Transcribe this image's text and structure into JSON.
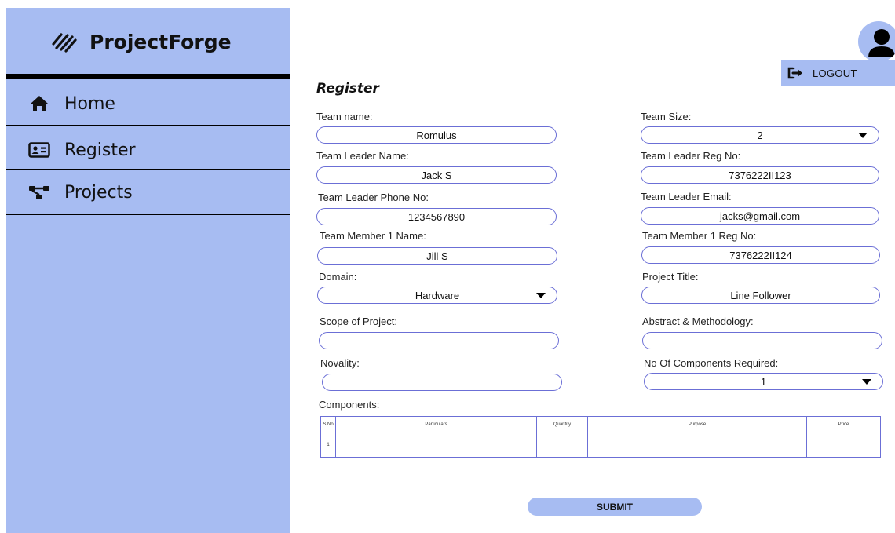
{
  "app": {
    "name": "ProjectForge"
  },
  "colors": {
    "accent": "#a7bcf2",
    "field_border": "#6b6fd6"
  },
  "sidebar": {
    "items": [
      {
        "label": "Home",
        "icon": "home-icon"
      },
      {
        "label": "Register",
        "icon": "id-card-icon"
      },
      {
        "label": "Projects",
        "icon": "flow-tree-icon"
      }
    ]
  },
  "header": {
    "logout_label": "LOGOUT",
    "avatar_icon": "user-avatar-icon"
  },
  "form": {
    "title": "Register",
    "team_name": {
      "label": "Team name:",
      "value": "Romulus"
    },
    "team_size": {
      "label": "Team Size:",
      "value": "2"
    },
    "leader_name": {
      "label": "Team Leader Name:",
      "value": "Jack S"
    },
    "leader_reg": {
      "label": "Team Leader Reg No:",
      "value": "7376222II123"
    },
    "leader_phone": {
      "label": "Team Leader Phone No:",
      "value": "1234567890"
    },
    "leader_email": {
      "label": "Team Leader Email:",
      "value": "jacks@gmail.com"
    },
    "member1_name": {
      "label": "Team Member 1 Name:",
      "value": "Jill S"
    },
    "member1_reg": {
      "label": "Team Member 1 Reg No:",
      "value": "7376222II124"
    },
    "domain": {
      "label": "Domain:",
      "value": "Hardware"
    },
    "project_title": {
      "label": "Project Title:",
      "value": "Line Follower"
    },
    "scope": {
      "label": "Scope of Project:",
      "value": ""
    },
    "abstract": {
      "label": "Abstract & Methodology:",
      "value": ""
    },
    "novelty": {
      "label": "Novality:",
      "value": ""
    },
    "num_components": {
      "label": "No Of Components Required:",
      "value": "1"
    },
    "components": {
      "label": "Components:",
      "headers": [
        "S.No",
        "Particulars",
        "Quantity",
        "Purpose",
        "Price"
      ],
      "rows": [
        [
          "1",
          "",
          "",
          "",
          ""
        ]
      ]
    },
    "submit_label": "SUBMIT"
  }
}
